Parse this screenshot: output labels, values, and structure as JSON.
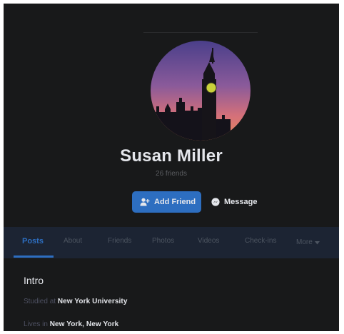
{
  "profile": {
    "name": "Susan Miller",
    "friends_count": "26 friends"
  },
  "actions": {
    "add_friend_label": "Add Friend",
    "add_friend_icon": "user-plus-icon",
    "message_label": "Message",
    "message_icon": "messenger-icon"
  },
  "tabs": [
    {
      "label": "Posts",
      "active": true
    },
    {
      "label": "About",
      "active": false
    },
    {
      "label": "Friends",
      "active": false
    },
    {
      "label": "Photos",
      "active": false
    },
    {
      "label": "Videos",
      "active": false
    },
    {
      "label": "Check-ins",
      "active": false
    },
    {
      "label": "More",
      "active": false
    }
  ],
  "intro": {
    "title": "Intro",
    "items": [
      {
        "prefix": "Studied at",
        "value": "New York University",
        "icon": "graduation-cap-icon"
      },
      {
        "prefix": "Lives in",
        "value": "New York, New York",
        "icon": "home-icon"
      }
    ]
  },
  "colors": {
    "background": "#18191a",
    "accent": "#2d6ec0",
    "tab_bar": "#1c2433",
    "text_primary": "#e4e6eb",
    "text_muted": "#5a5c60"
  }
}
